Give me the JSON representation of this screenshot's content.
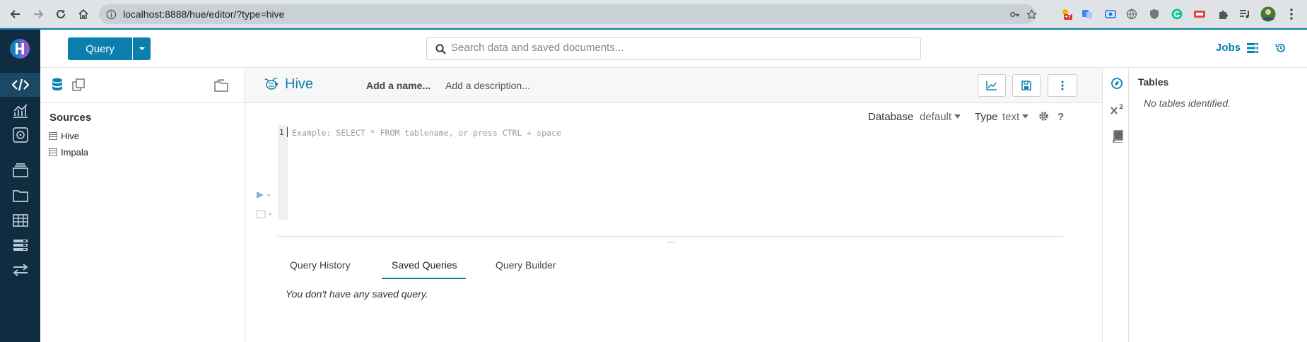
{
  "browser": {
    "url": "localhost:8888/hue/editor/?type=hive",
    "badge_count": "+7"
  },
  "topbar": {
    "query_label": "Query",
    "search_placeholder": "Search data and saved documents...",
    "jobs_label": "Jobs"
  },
  "assist": {
    "sources_title": "Sources",
    "sources": [
      {
        "label": "Hive"
      },
      {
        "label": "Impala"
      }
    ]
  },
  "editor": {
    "title": "Hive",
    "add_name": "Add a name...",
    "add_description": "Add a description...",
    "database_label": "Database",
    "database_value": "default",
    "type_label": "Type",
    "type_value": "text",
    "help_label": "?",
    "line_number": "1",
    "placeholder": "Example: SELECT * FROM tablename, or press CTRL + space"
  },
  "tabs": {
    "items": [
      {
        "label": "Query History"
      },
      {
        "label": "Saved Queries"
      },
      {
        "label": "Query Builder"
      }
    ],
    "active": "Saved Queries",
    "empty_message": "You don't have any saved query."
  },
  "right_panel": {
    "tables_title": "Tables",
    "empty_message": "No tables identified."
  },
  "colors": {
    "accent": "#0b7fad",
    "nav_bg": "#0f2c40",
    "nav_active": "#1b4865"
  }
}
